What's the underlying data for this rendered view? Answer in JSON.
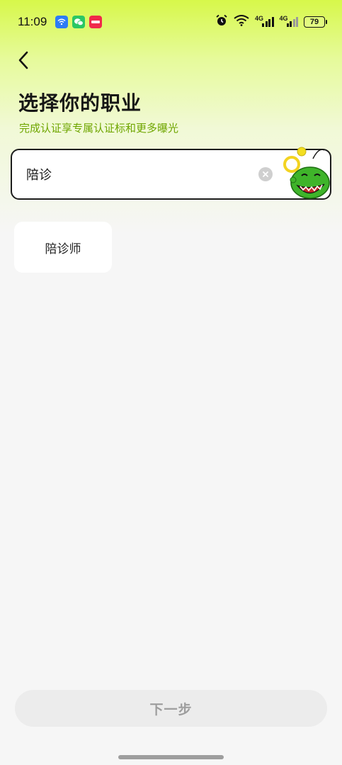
{
  "status_bar": {
    "time": "11:09",
    "network_1": "4G",
    "network_2": "4G",
    "battery": "79",
    "icons": [
      "wifi-app-icon",
      "wechat-icon",
      "xiaohongshu-icon",
      "alarm-icon",
      "wifi-icon",
      "signal-icon",
      "battery-icon"
    ]
  },
  "header": {
    "title": "选择你的职业",
    "subtitle": "完成认证享专属认证标和更多曝光"
  },
  "search": {
    "value": "陪诊"
  },
  "results": [
    {
      "label": "陪诊师"
    }
  ],
  "footer": {
    "next_label": "下一步"
  },
  "colors": {
    "accent": "#d7f84a",
    "subtitle": "#6fa600",
    "button_bg": "#ececec",
    "button_text": "#9d9d9d"
  }
}
